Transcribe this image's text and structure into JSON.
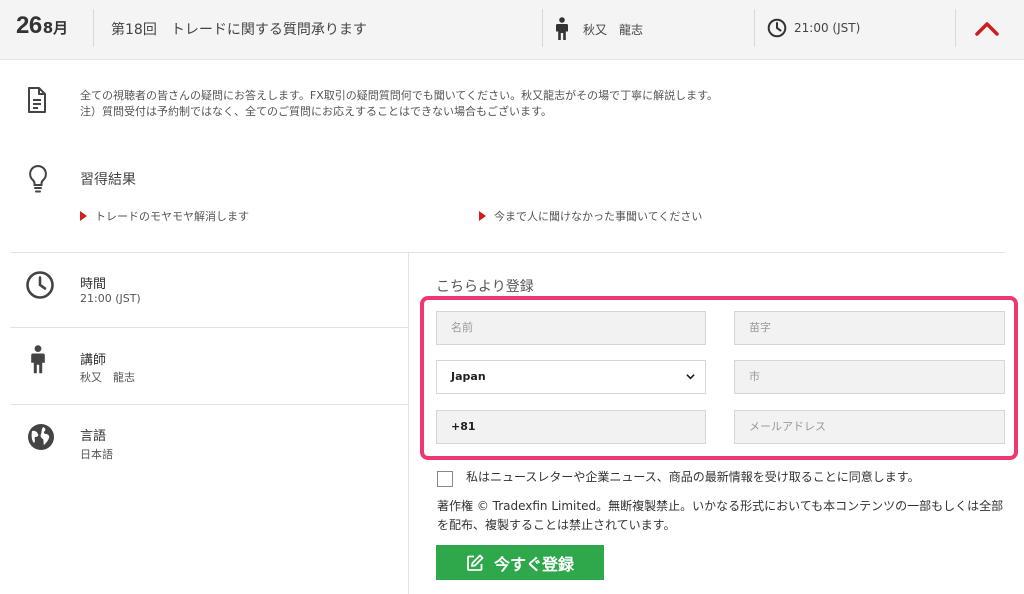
{
  "header": {
    "day": "26",
    "month": "8月",
    "title": "第18回　トレードに関する質問承ります",
    "instructor": "秋又　龍志",
    "time": "21:00 (JST)"
  },
  "description": {
    "line1": "全ての視聴者の皆さんの疑問にお答えします。FX取引の疑問質問何でも聞いてください。秋又龍志がその場で丁寧に解説します。",
    "line2": "注）質問受付は予約制ではなく、全てのご質問にお応えすることはできない場合もございます。"
  },
  "learning": {
    "title": "習得結果",
    "bullets": [
      "トレードのモヤモヤ解消します",
      "今まで人に聞けなかった事聞いてください"
    ]
  },
  "info": {
    "time_label": "時間",
    "time_value": "21:00 (JST)",
    "instructor_label": "講師",
    "instructor_value": "秋又　龍志",
    "language_label": "言語",
    "language_value": "日本語"
  },
  "form": {
    "heading": "こちらより登録",
    "first_name_placeholder": "名前",
    "last_name_placeholder": "苗字",
    "country_value": "Japan",
    "city_placeholder": "市",
    "phone_value": "+81",
    "email_placeholder": "メールアドレス",
    "consent_text": "私はニュースレターや企業ニュース、商品の最新情報を受け取ることに同意します。",
    "copyright_text": "著作権 © Tradexfin Limited。無断複製禁止。いかなる形式においても本コンテンツの一部もしくは全部を配布、複製することは禁止されています。",
    "submit_label": "今すぐ登録"
  },
  "colors": {
    "accent_red": "#cc1f1f",
    "highlight": "#f0366e",
    "button_green": "#2fa84b"
  },
  "icons": [
    "person-icon",
    "clock-icon",
    "chevron-up-icon",
    "document-icon",
    "lightbulb-icon",
    "globe-icon",
    "edit-icon"
  ]
}
